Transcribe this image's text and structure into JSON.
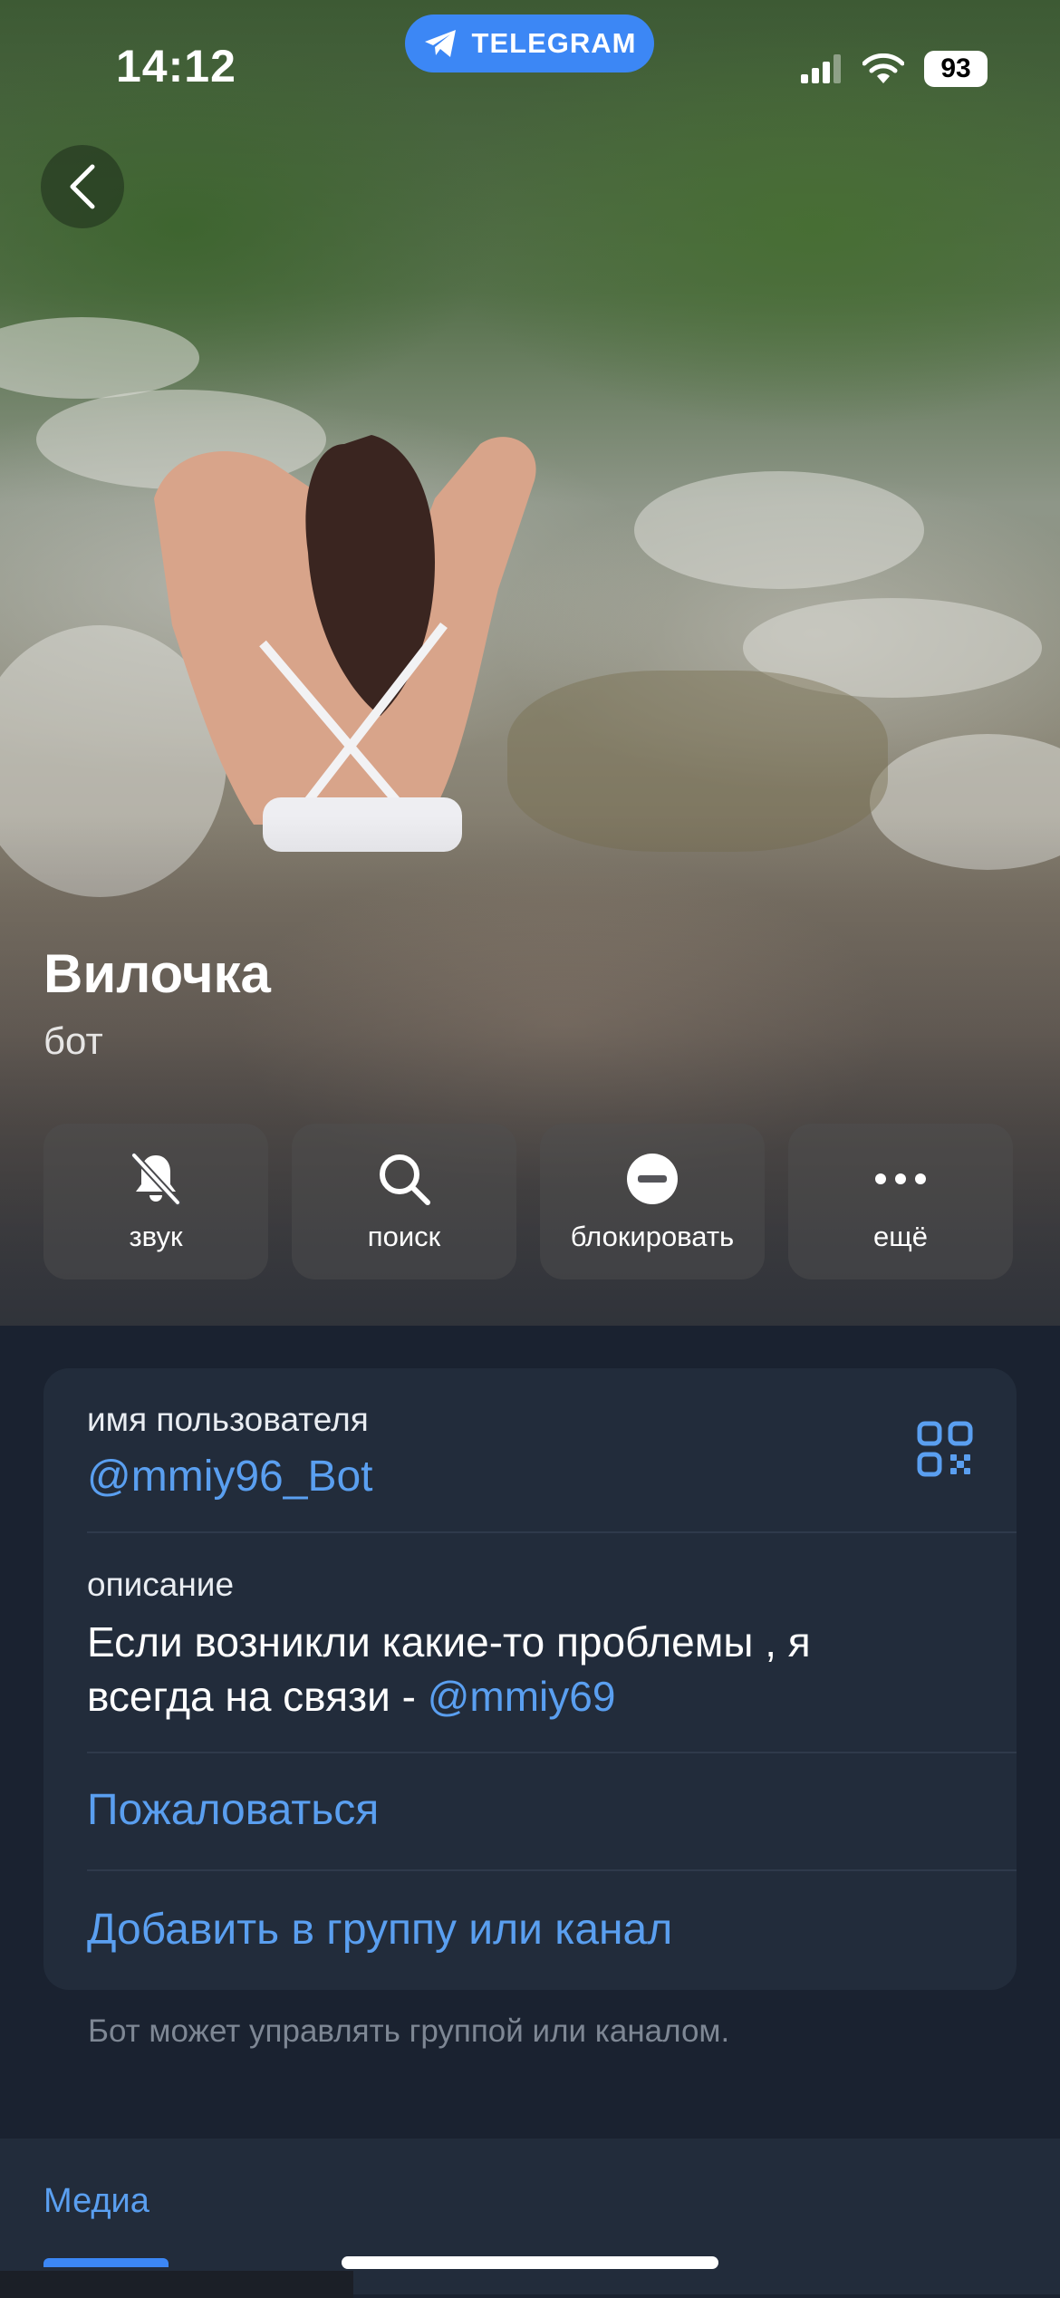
{
  "status_bar": {
    "time": "14:12",
    "app_pill": "TELEGRAM",
    "battery": "93",
    "icons": [
      "signal-icon",
      "wifi-icon",
      "battery-icon"
    ]
  },
  "profile": {
    "name": "Вилочка",
    "status": "бот"
  },
  "actions": [
    {
      "label": "звук",
      "icon": "bell-slash-icon"
    },
    {
      "label": "поиск",
      "icon": "search-icon"
    },
    {
      "label": "блокировать",
      "icon": "block-icon"
    },
    {
      "label": "ещё",
      "icon": "more-icon"
    }
  ],
  "info": {
    "username_caption": "имя пользователя",
    "username_value": "@mmiy96_Bot",
    "description_caption": "описание",
    "description_text": "Если возникли какие-то проблемы , я",
    "description_text_line2": "всегда на связи - ",
    "description_mention": "@mmiy69",
    "report_label": "Пожаловаться",
    "add_to_group_label": "Добавить в группу или канал"
  },
  "footnote": "Бот может управлять группой или каналом.",
  "media": {
    "tab_label": "Медиа"
  },
  "colors": {
    "accent": "#5a9ff0",
    "pill": "#3c87f5",
    "background": "#1a2230",
    "card": "#222c3b"
  }
}
